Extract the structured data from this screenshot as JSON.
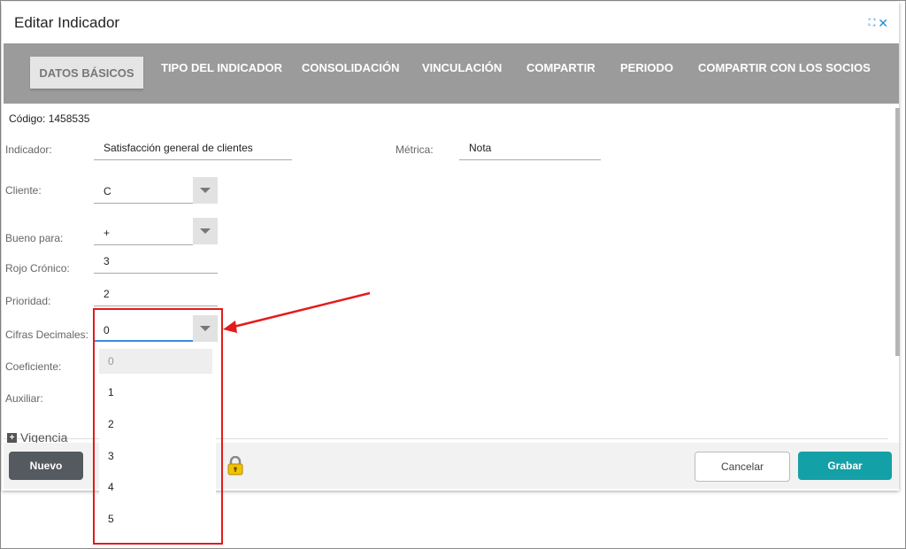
{
  "dialog": {
    "title": "Editar Indicador"
  },
  "tabs": [
    "DATOS BÁSICOS",
    "TIPO DEL INDICADOR",
    "CONSOLIDACIÓN",
    "VINCULACIÓN",
    "COMPARTIR",
    "PERIODO",
    "COMPARTIR CON LOS SOCIOS"
  ],
  "active_tab": "DATOS BÁSICOS",
  "form": {
    "codigo": "Código: 1458535",
    "indicador_label": "Indicador:",
    "indicador_value": "Satisfacción general de clientes",
    "metrica_label": "Métrica:",
    "metrica_value": "Nota",
    "cliente_label": "Cliente:",
    "cliente_value": "C",
    "bueno_label": "Bueno para:",
    "bueno_value": "+",
    "rojo_label": "Rojo Crónico:",
    "rojo_value": "3",
    "prioridad_label": "Prioridad:",
    "prioridad_value": "2",
    "cifras_label": "Cifras Decimales:",
    "cifras_value": "0",
    "coeficiente_label": "Coeficiente:",
    "auxiliar_label": "Auxiliar:"
  },
  "dropdown_options": [
    "0",
    "1",
    "2",
    "3",
    "4",
    "5"
  ],
  "section": {
    "vigencia": "Vigencia"
  },
  "buttons": {
    "nuevo": "Nuevo",
    "cancelar": "Cancelar",
    "grabar": "Grabar"
  },
  "colors": {
    "accent": "#13a0a6",
    "annotation": "#e31b1b",
    "tabbar": "#9b9b9b"
  }
}
